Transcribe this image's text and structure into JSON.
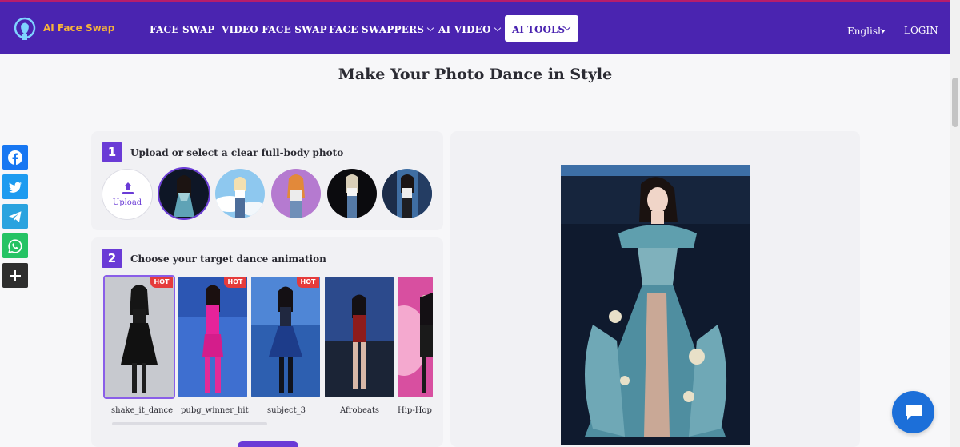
{
  "nav": {
    "logo_text": "AI Face Swap",
    "items": [
      {
        "label": "FACE SWAP"
      },
      {
        "label": "VIDEO FACE SWAP"
      },
      {
        "label": "FACE SWAPPERS"
      },
      {
        "label": "AI VIDEO"
      },
      {
        "label": "AI TOOLS"
      }
    ],
    "language": "English",
    "login": "LOGIN"
  },
  "page": {
    "title": "Make Your Photo Dance in Style"
  },
  "share": {
    "buttons": [
      {
        "icon": "facebook-icon",
        "color": "#1877f2"
      },
      {
        "icon": "twitter-icon",
        "color": "#1d9bf0"
      },
      {
        "icon": "telegram-icon",
        "color": "#2aa3df"
      },
      {
        "icon": "whatsapp-icon",
        "color": "#25c364"
      },
      {
        "icon": "plus-icon",
        "color": "#2e2e2e"
      }
    ]
  },
  "step1": {
    "number": "1",
    "text": "Upload or select a clear full-body photo",
    "upload_label": "Upload"
  },
  "step2": {
    "number": "2",
    "text": "Choose your target dance animation",
    "hot_badge": "HOT",
    "dances": [
      {
        "label": "shake_it_dance",
        "hot": true
      },
      {
        "label": "pubg_winner_hit",
        "hot": true
      },
      {
        "label": "subject_3",
        "hot": true
      },
      {
        "label": "Afrobeats",
        "hot": false
      },
      {
        "label": "Hip-Hop",
        "hot": false
      }
    ]
  },
  "colors": {
    "nav_bg": "#4a24b0",
    "accent": "#6a3bd6",
    "hot": "#e53b3b",
    "chat": "#1c6fd9"
  }
}
